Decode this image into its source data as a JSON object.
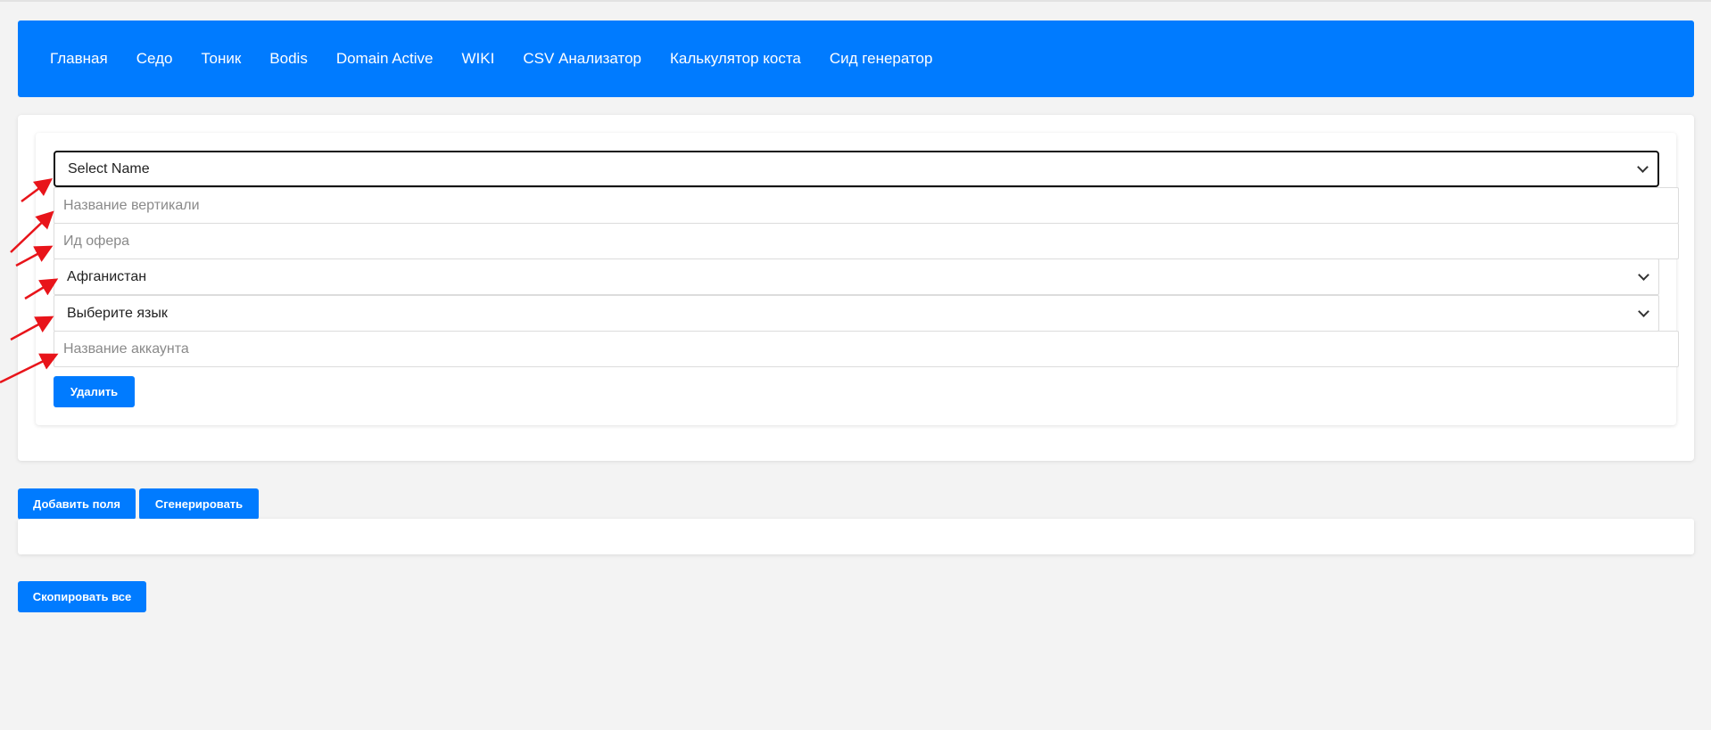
{
  "nav": {
    "items": [
      {
        "label": "Главная"
      },
      {
        "label": "Седо"
      },
      {
        "label": "Тоник"
      },
      {
        "label": "Bodis"
      },
      {
        "label": "Domain Active"
      },
      {
        "label": "WIKI"
      },
      {
        "label": "CSV Анализатор"
      },
      {
        "label": "Калькулятор коста"
      },
      {
        "label": "Сид генератор"
      }
    ]
  },
  "form": {
    "name_select": {
      "value": "Select Name"
    },
    "vertical_input": {
      "placeholder": "Название вертикали",
      "value": ""
    },
    "offer_input": {
      "placeholder": "Ид офера",
      "value": ""
    },
    "country_select": {
      "value": "Афганистан"
    },
    "language_select": {
      "value": "Выберите язык"
    },
    "account_input": {
      "placeholder": "Название аккаунта",
      "value": ""
    },
    "delete_label": "Удалить"
  },
  "actions": {
    "add_fields_label": "Добавить поля",
    "generate_label": "Сгенерировать",
    "copy_all_label": "Скопировать все"
  },
  "colors": {
    "accent": "#007bff",
    "annotation_arrow": "#e8141a",
    "page_background": "#f3f3f3"
  },
  "icons": [
    "chevron-down-icon",
    "annotation-arrow-icon"
  ]
}
